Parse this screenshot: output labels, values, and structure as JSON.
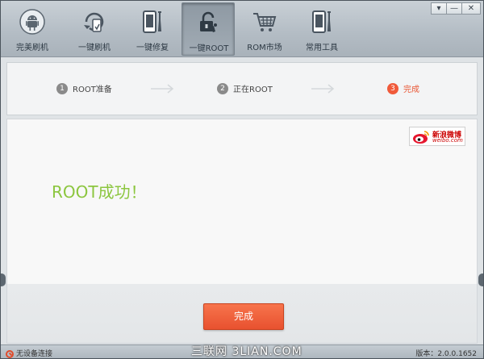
{
  "window_controls": {
    "menu": "▾",
    "minimize": "—",
    "close": "✕"
  },
  "toolbar": {
    "items": [
      {
        "label": "完美刷机",
        "icon": "android-icon"
      },
      {
        "label": "一键刷机",
        "icon": "refresh-phone-icon"
      },
      {
        "label": "一键修复",
        "icon": "repair-phone-icon"
      },
      {
        "label": "一键ROOT",
        "icon": "root-lock-icon",
        "active": true
      },
      {
        "label": "ROM市场",
        "icon": "cart-icon"
      },
      {
        "label": "常用工具",
        "icon": "tools-icon"
      }
    ]
  },
  "steps": [
    {
      "num": "1",
      "label": "ROOT准备"
    },
    {
      "num": "2",
      "label": "正在ROOT"
    },
    {
      "num": "3",
      "label": "完成",
      "current": true
    }
  ],
  "weibo": {
    "line1": "新浪微博",
    "line2": "weibo.com"
  },
  "main": {
    "message": "ROOT成功！",
    "done_button": "完成"
  },
  "status": {
    "connection": "无设备连接",
    "version": "版本：2.0.0.1652"
  },
  "watermark": "三联网 3LIAN.COM",
  "colors": {
    "accent": "#e95634",
    "success": "#8cc63f"
  }
}
